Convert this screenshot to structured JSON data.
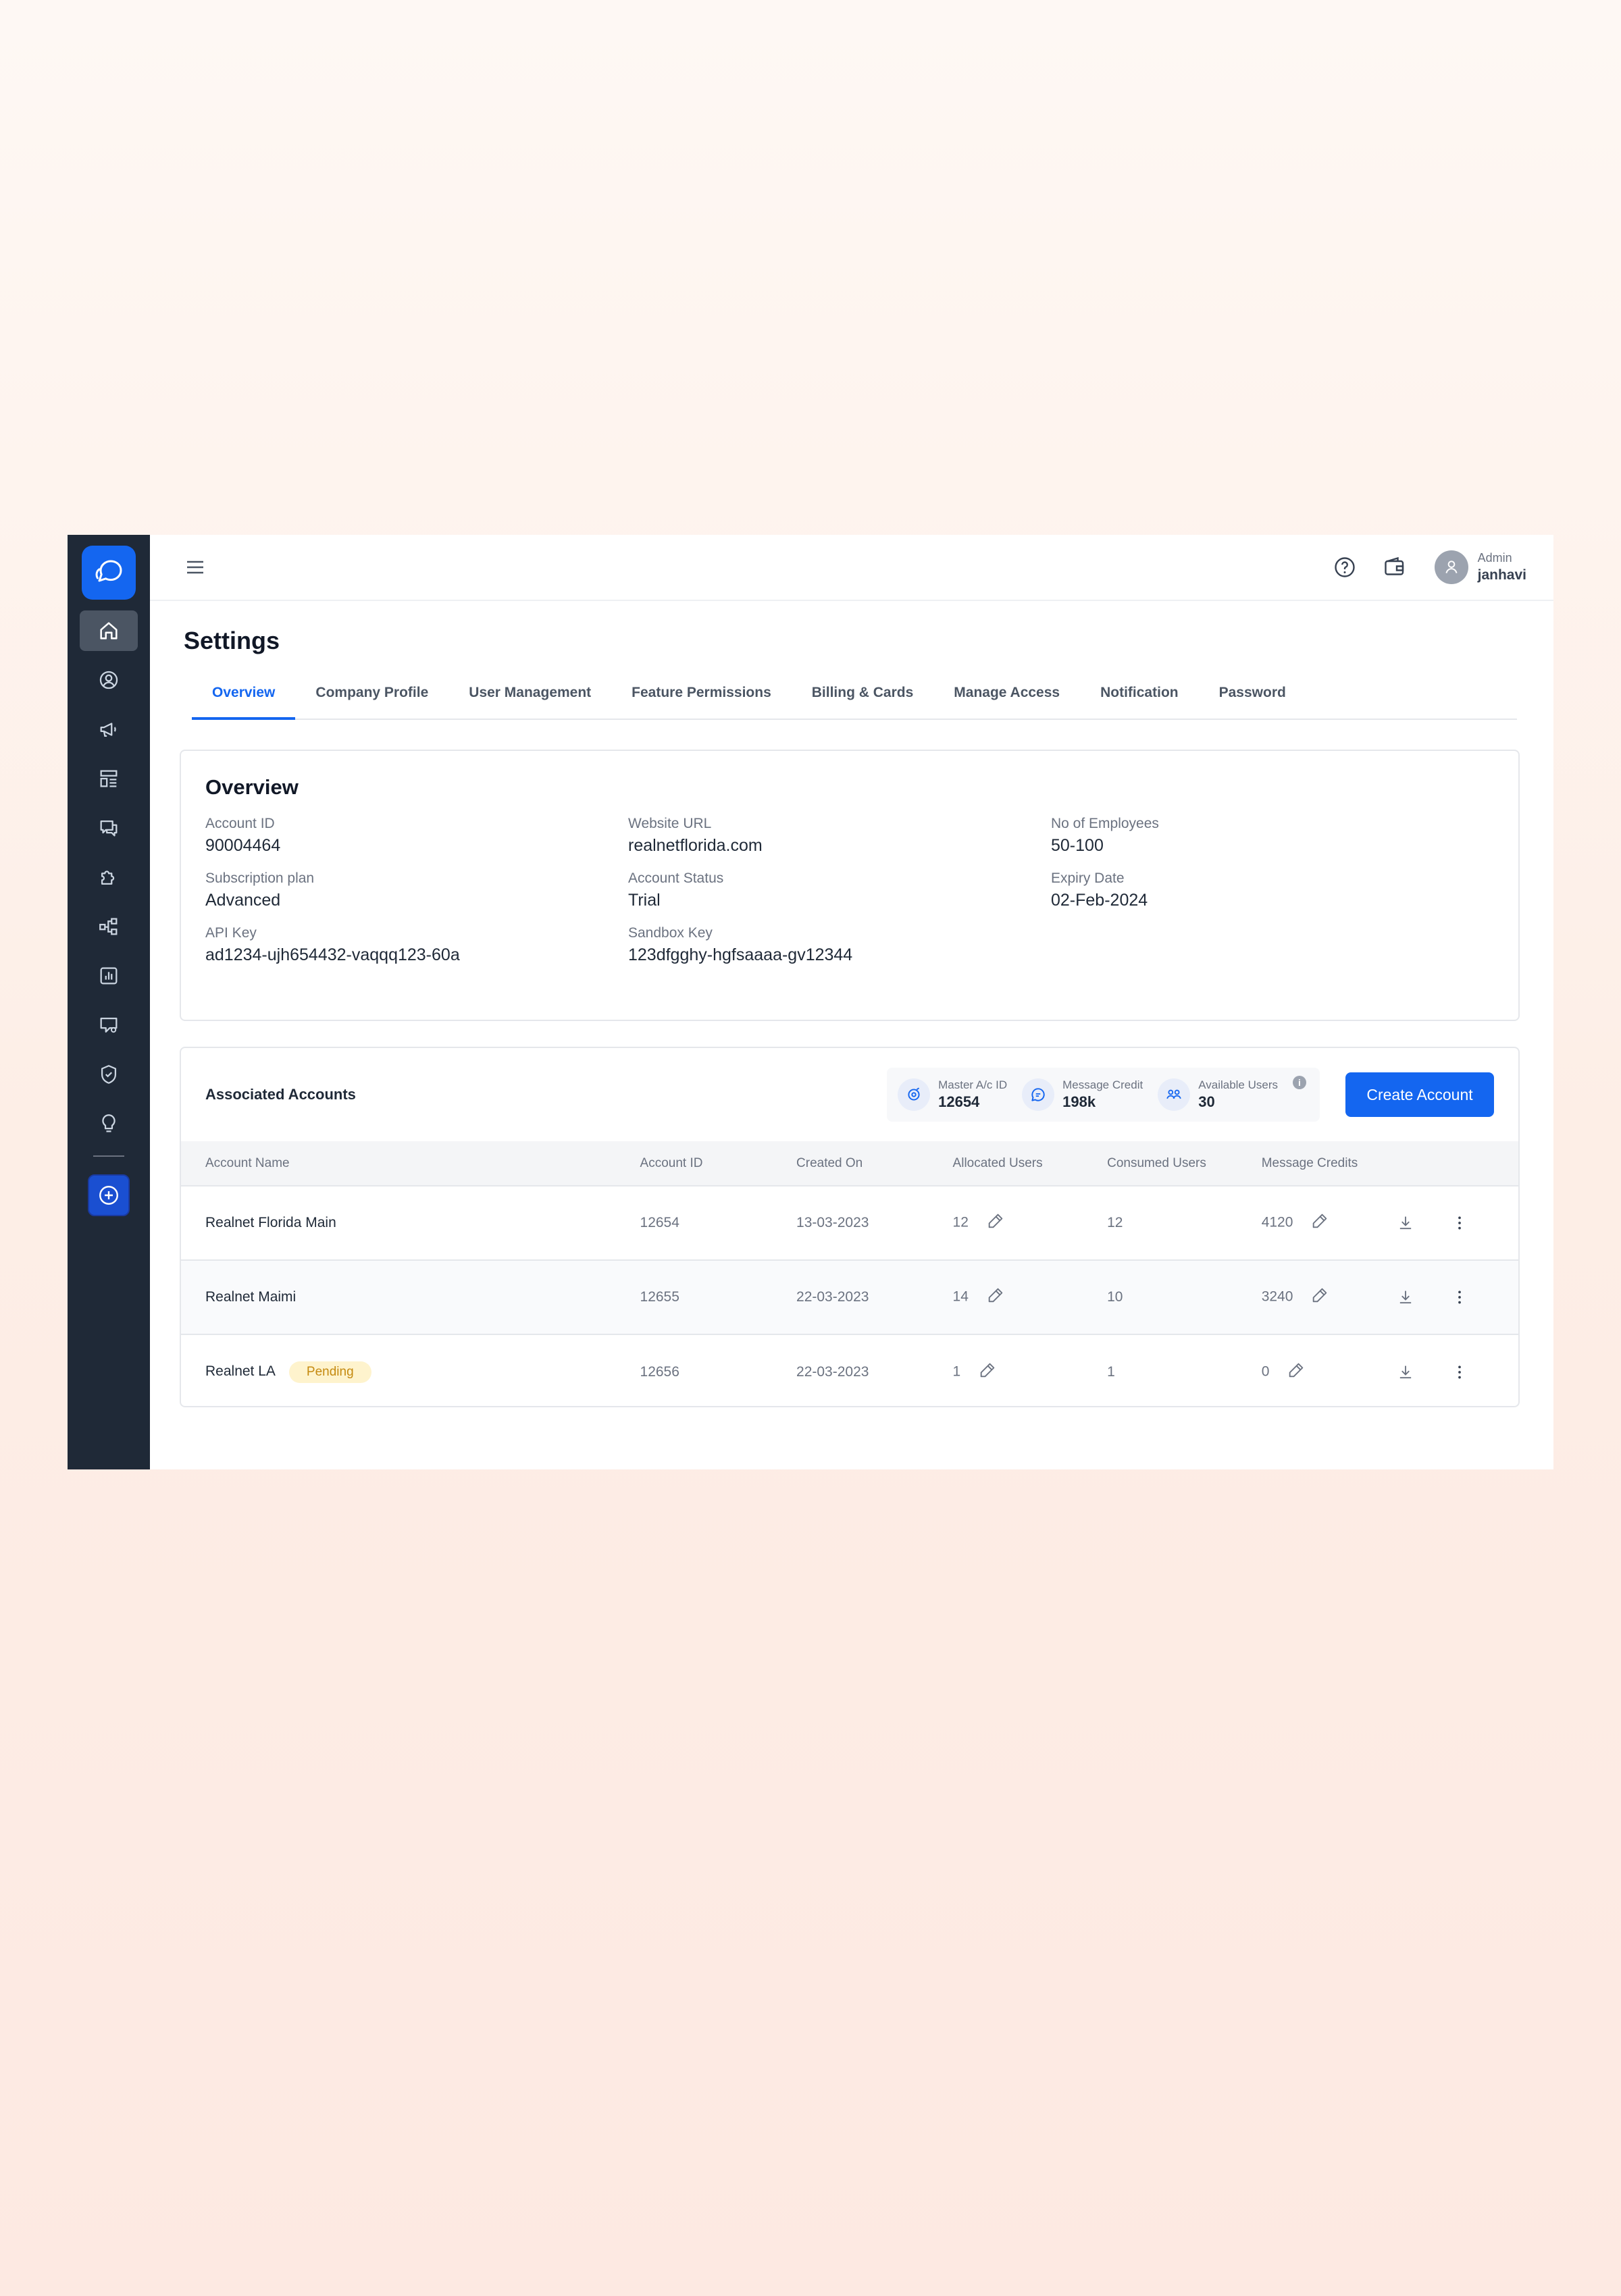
{
  "header": {
    "role": "Admin",
    "username": "janhavi"
  },
  "page": {
    "title": "Settings"
  },
  "tabs": [
    {
      "label": "Overview"
    },
    {
      "label": "Company Profile"
    },
    {
      "label": "User Management"
    },
    {
      "label": "Feature Permissions"
    },
    {
      "label": "Billing & Cards"
    },
    {
      "label": "Manage Access"
    },
    {
      "label": "Notification"
    },
    {
      "label": "Password"
    }
  ],
  "active_tab": "Overview",
  "overview": {
    "title": "Overview",
    "fields": [
      {
        "label": "Account ID",
        "value": "90004464"
      },
      {
        "label": "Website URL",
        "value": "realnetflorida.com"
      },
      {
        "label": "No of Employees",
        "value": "50-100"
      },
      {
        "label": "Subscription plan",
        "value": "Advanced"
      },
      {
        "label": "Account Status",
        "value": "Trial"
      },
      {
        "label": "Expiry Date",
        "value": "02-Feb-2024"
      },
      {
        "label": "API Key",
        "value": "ad1234-ujh654432-vaqqq123-60a"
      },
      {
        "label": "Sandbox Key",
        "value": "123dfgghy-hgfsaaaa-gv12344"
      }
    ]
  },
  "associated": {
    "title": "Associated Accounts",
    "stats": [
      {
        "label": "Master A/c ID",
        "value": "12654",
        "icon": "master-account-icon"
      },
      {
        "label": "Message Credit",
        "value": "198k",
        "icon": "message-credit-icon"
      },
      {
        "label": "Available Users",
        "value": "30",
        "icon": "users-icon"
      }
    ],
    "info_glyph": "i",
    "create_button": "Create Account",
    "columns": [
      "Account Name",
      "Account ID",
      "Created On",
      "Allocated Users",
      "Consumed Users",
      "Message Credits"
    ],
    "rows": [
      {
        "name": "Realnet Florida Main",
        "badge": "",
        "id": "12654",
        "created": "13-03-2023",
        "allocated": "12",
        "consumed": "12",
        "credits": "4120"
      },
      {
        "name": "Realnet Maimi",
        "badge": "",
        "id": "12655",
        "created": "22-03-2023",
        "allocated": "14",
        "consumed": "10",
        "credits": "3240"
      },
      {
        "name": "Realnet LA",
        "badge": "Pending",
        "id": "12656",
        "created": "22-03-2023",
        "allocated": "1",
        "consumed": "1",
        "credits": "0"
      }
    ]
  },
  "colors": {
    "accent": "#1466f0",
    "sidebar": "#1f2937",
    "pending_bg": "#fef3cd",
    "pending_text": "#c58a10"
  }
}
